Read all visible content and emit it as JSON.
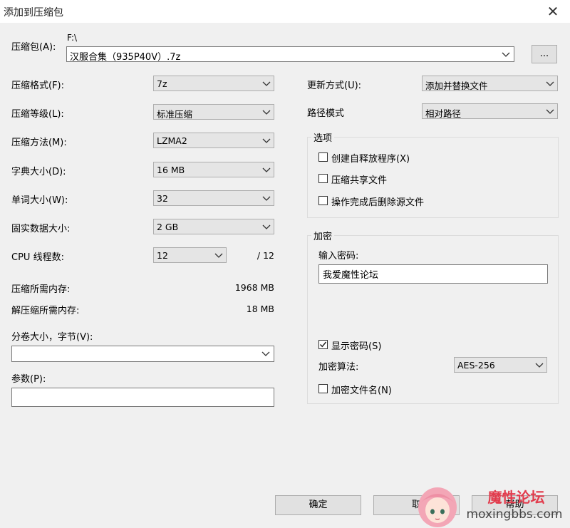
{
  "window": {
    "title": "添加到压缩包",
    "close_glyph": "✕"
  },
  "archive": {
    "label": "压缩包(A):",
    "path": "F:\\",
    "filename": "汉服合集（935P40V）.7z",
    "browse_label": "..."
  },
  "left": {
    "format": {
      "label": "压缩格式(F):",
      "value": "7z"
    },
    "level": {
      "label": "压缩等级(L):",
      "value": "标准压缩"
    },
    "method": {
      "label": "压缩方法(M):",
      "value": "LZMA2"
    },
    "dict": {
      "label": "字典大小(D):",
      "value": "16 MB"
    },
    "word": {
      "label": "单词大小(W):",
      "value": "32"
    },
    "solid": {
      "label": "固实数据大小:",
      "value": "2 GB"
    },
    "threads": {
      "label": "CPU 线程数:",
      "value": "12",
      "max": "/ 12"
    },
    "mem_compress": {
      "label": "压缩所需内存:",
      "value": "1968 MB"
    },
    "mem_decompress": {
      "label": "解压缩所需内存:",
      "value": "18 MB"
    },
    "volume": {
      "label": "分卷大小，字节(V):",
      "value": ""
    },
    "params": {
      "label": "参数(P):",
      "value": ""
    }
  },
  "right": {
    "update": {
      "label": "更新方式(U):",
      "value": "添加并替换文件"
    },
    "pathmode": {
      "label": "路径模式",
      "value": "相对路径"
    },
    "options": {
      "title": "选项",
      "sfx": {
        "label": "创建自释放程序(X)",
        "checked": false
      },
      "shared": {
        "label": "压缩共享文件",
        "checked": false
      },
      "delete": {
        "label": "操作完成后删除源文件",
        "checked": false
      }
    },
    "encryption": {
      "title": "加密",
      "password_label": "输入密码:",
      "password_value": "我爱魔性论坛",
      "show_password": {
        "label": "显示密码(S)",
        "checked": true
      },
      "method_label": "加密算法:",
      "method_value": "AES-256",
      "encrypt_names": {
        "label": "加密文件名(N)",
        "checked": false
      }
    }
  },
  "buttons": {
    "ok": "确定",
    "cancel": "取",
    "help": "帮助"
  },
  "watermark": {
    "text": "魔性论坛",
    "url": "moxingbbs.com"
  },
  "colors": {
    "bg": "#f0f0f0",
    "combo_bg": "#e5e5e5",
    "watermark_red": "#e23b4c"
  }
}
